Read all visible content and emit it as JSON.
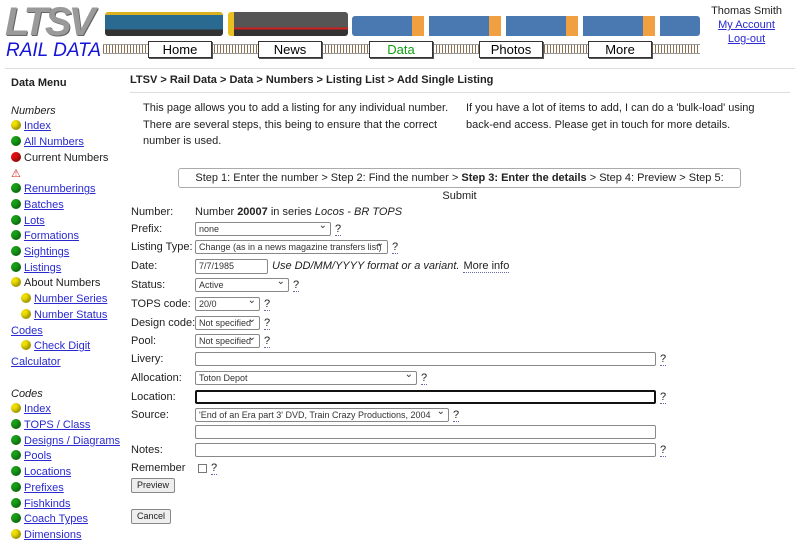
{
  "header": {
    "logo": "LTSV",
    "subtitle": "RAIL DATA",
    "nav": [
      "Home",
      "News",
      "Data",
      "Photos",
      "More"
    ],
    "active_nav": "Data",
    "user": "Thomas Smith",
    "account": "My Account",
    "logout": "Log-out"
  },
  "sidebar": {
    "title": "Data Menu",
    "numbers_heading": "Numbers",
    "numbers": [
      {
        "label": "Index",
        "dot": "y",
        "link": true
      },
      {
        "label": "All Numbers",
        "dot": "g",
        "link": true
      },
      {
        "label": "Current Numbers",
        "dot": "r",
        "link": false
      },
      {
        "label": "",
        "dot": "warn",
        "link": false
      },
      {
        "label": "Renumberings",
        "dot": "g",
        "link": true
      },
      {
        "label": "Batches",
        "dot": "g",
        "link": true
      },
      {
        "label": "Lots",
        "dot": "g",
        "link": true
      },
      {
        "label": "Formations",
        "dot": "g",
        "link": true
      },
      {
        "label": "Sightings",
        "dot": "g",
        "link": true
      },
      {
        "label": "Listings",
        "dot": "g",
        "link": true
      },
      {
        "label": "About Numbers",
        "dot": "y",
        "link": false
      },
      {
        "label": "Number Series",
        "dot": "y",
        "link": true,
        "indent": true
      },
      {
        "label": "Number Status",
        "dot": "y",
        "link": true,
        "indent": true
      },
      {
        "label": "Codes",
        "dot": "",
        "link": true
      },
      {
        "label": "Check Digit",
        "dot": "y",
        "link": true,
        "indent": true
      },
      {
        "label": "Calculator",
        "dot": "",
        "link": true
      }
    ],
    "codes_heading": "Codes",
    "codes": [
      {
        "label": "Index",
        "dot": "y"
      },
      {
        "label": "TOPS / Class",
        "dot": "g"
      },
      {
        "label": "Designs / Diagrams",
        "dot": "g"
      },
      {
        "label": "Pools",
        "dot": "g"
      },
      {
        "label": "Locations",
        "dot": "g"
      },
      {
        "label": "Prefixes",
        "dot": "g"
      },
      {
        "label": "Fishkinds",
        "dot": "g"
      },
      {
        "label": "Coach Types",
        "dot": "g"
      },
      {
        "label": "Dimensions",
        "dot": "y"
      }
    ]
  },
  "main": {
    "breadcrumb": "LTSV > Rail Data > Data > Numbers > Listing List > Add Single Listing",
    "intro_left": "This page allows you to add a listing for any individual number. There are several steps, this being to ensure that the correct number is used.",
    "intro_right": "If you have a lot of items to add, I can do a 'bulk-load' using back-end access. Please get in touch for more details.",
    "steps": {
      "s1": "Step 1: Enter the number > Step 2: Find the number > ",
      "s3": "Step 3: Enter the details",
      "s45": " > Step 4: Preview > Step 5: Submit"
    },
    "form": {
      "number_label": "Number:",
      "number_pre": "Number ",
      "number": "20007",
      "number_mid": " in series ",
      "series": "Locos - BR TOPS",
      "prefix_label": "Prefix:",
      "prefix": "none",
      "type_label": "Listing Type:",
      "type": "Change (as in a news magazine transfers list)",
      "date_label": "Date:",
      "date": "7/7/1985",
      "date_hint": "Use DD/MM/YYYY format or a variant.",
      "more_info": "More info",
      "status_label": "Status:",
      "status": "Active",
      "tops_label": "TOPS code:",
      "tops": "20/0",
      "design_label": "Design code:",
      "design": "Not specified",
      "pool_label": "Pool:",
      "pool": "Not specified",
      "livery_label": "Livery:",
      "livery": "",
      "alloc_label": "Allocation:",
      "alloc": "Toton Depot",
      "location_label": "Location:",
      "location": "",
      "source_label": "Source:",
      "source": "'End of an Era part 3' DVD, Train Crazy Productions, 2004",
      "source2": "",
      "notes_label": "Notes:",
      "notes": "",
      "remember_label": "Remember",
      "q": "?",
      "preview": "Preview",
      "cancel": "Cancel"
    }
  }
}
